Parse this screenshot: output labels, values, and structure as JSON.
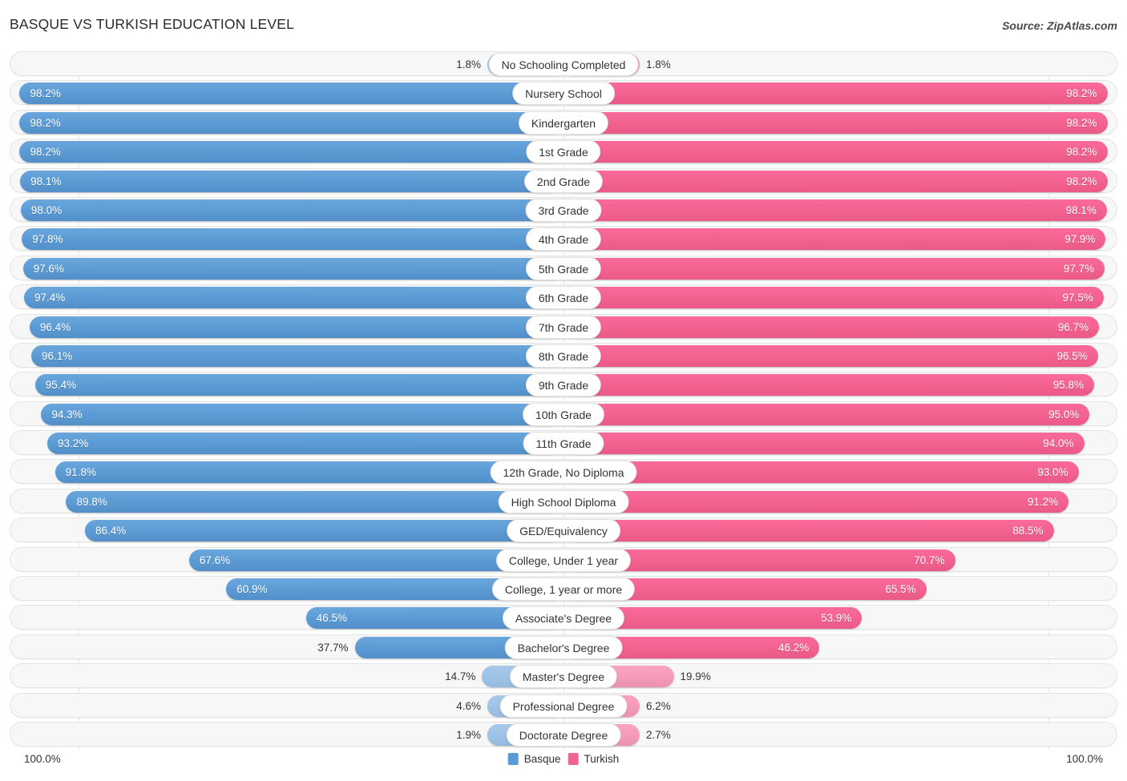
{
  "header": {
    "title": "BASQUE VS TURKISH EDUCATION LEVEL",
    "source": "Source: ZipAtlas.com"
  },
  "legend": {
    "items": [
      {
        "label": "Basque",
        "color": "#5b9bd5"
      },
      {
        "label": "Turkish",
        "color": "#f4628f"
      }
    ]
  },
  "axis": {
    "left_max": "100.0%",
    "right_max": "100.0%"
  },
  "chart_data": {
    "type": "bar",
    "orientation": "horizontal",
    "style": "diverging-butterfly",
    "title": "BASQUE VS TURKISH EDUCATION LEVEL",
    "xlabel": "",
    "ylabel": "",
    "xlim": [
      0,
      100
    ],
    "grid": true,
    "legend_position": "bottom-center",
    "categories": [
      "No Schooling Completed",
      "Nursery School",
      "Kindergarten",
      "1st Grade",
      "2nd Grade",
      "3rd Grade",
      "4th Grade",
      "5th Grade",
      "6th Grade",
      "7th Grade",
      "8th Grade",
      "9th Grade",
      "10th Grade",
      "11th Grade",
      "12th Grade, No Diploma",
      "High School Diploma",
      "GED/Equivalency",
      "College, Under 1 year",
      "College, 1 year or more",
      "Associate's Degree",
      "Bachelor's Degree",
      "Master's Degree",
      "Professional Degree",
      "Doctorate Degree"
    ],
    "series": [
      {
        "name": "Basque",
        "color": "#5b9bd5",
        "values": [
          1.8,
          98.2,
          98.2,
          98.2,
          98.1,
          98.0,
          97.8,
          97.6,
          97.4,
          96.4,
          96.1,
          95.4,
          94.3,
          93.2,
          91.8,
          89.8,
          86.4,
          67.6,
          60.9,
          46.5,
          37.7,
          14.7,
          4.6,
          1.9
        ],
        "labels": [
          "1.8%",
          "98.2%",
          "98.2%",
          "98.2%",
          "98.1%",
          "98.0%",
          "97.8%",
          "97.6%",
          "97.4%",
          "96.4%",
          "96.1%",
          "95.4%",
          "94.3%",
          "93.2%",
          "91.8%",
          "89.8%",
          "86.4%",
          "67.6%",
          "60.9%",
          "46.5%",
          "37.7%",
          "14.7%",
          "4.6%",
          "1.9%"
        ]
      },
      {
        "name": "Turkish",
        "color": "#f4628f",
        "values": [
          1.8,
          98.2,
          98.2,
          98.2,
          98.2,
          98.1,
          97.9,
          97.7,
          97.5,
          96.7,
          96.5,
          95.8,
          95.0,
          94.0,
          93.0,
          91.2,
          88.5,
          70.7,
          65.5,
          53.9,
          46.2,
          19.9,
          6.2,
          2.7
        ],
        "labels": [
          "1.8%",
          "98.2%",
          "98.2%",
          "98.2%",
          "98.2%",
          "98.1%",
          "97.9%",
          "97.7%",
          "97.5%",
          "96.7%",
          "96.5%",
          "95.8%",
          "95.0%",
          "94.0%",
          "93.0%",
          "91.2%",
          "88.5%",
          "70.7%",
          "65.5%",
          "53.9%",
          "46.2%",
          "19.9%",
          "6.2%",
          "2.7%"
        ]
      }
    ]
  }
}
